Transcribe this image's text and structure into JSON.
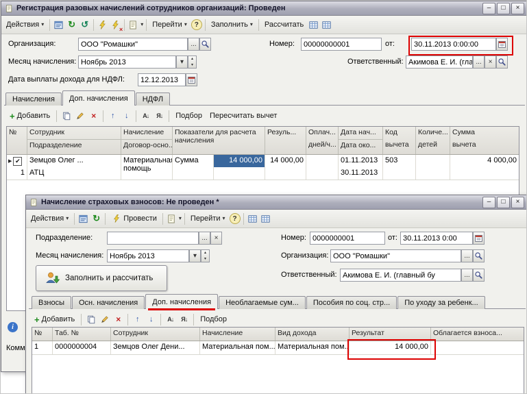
{
  "annotation_color": "#dd0000",
  "chrome": {
    "minimize": "–",
    "maximize": "□",
    "close": "×"
  },
  "glyphs": {
    "dropdown": "▾",
    "ellipsis": "...",
    "clear": "×",
    "spin_up": "▴",
    "spin_down": "▾",
    "help": "?",
    "marker": "▶",
    "check": "✔",
    "plus": "+",
    "remove": "×",
    "move_up": "↑",
    "move_down": "↓",
    "sort_asc": "А↓",
    "sort_desc": "Я↓",
    "refresh": "↻",
    "refresh2": "↺",
    "info": "i"
  },
  "win1": {
    "title": "Регистрация разовых начислений сотрудников организаций: Проведен",
    "toolbar": {
      "actions": "Действия",
      "goto": "Перейти",
      "fill": "Заполнить",
      "calc": "Рассчитать"
    },
    "fields": {
      "org_label": "Организация:",
      "org_value": "ООО \"Ромашки\"",
      "number_label": "Номер:",
      "number_value": "00000000001",
      "from_label": "от:",
      "date_value": "30.11.2013  0:00:00",
      "month_label": "Месяц начисления:",
      "month_value": "Ноябрь 2013",
      "resp_label": "Ответственный:",
      "resp_value": "Акимова Е. И. (главный бухгалтер)",
      "ndfl_label": "Дата выплаты дохода для НДФЛ:",
      "ndfl_value": "12.12.2013"
    },
    "tabs": [
      "Начисления",
      "Доп. начисления",
      "НДФЛ"
    ],
    "grid_toolbar": {
      "add": "Добавить",
      "pick": "Подбор",
      "recalc": "Пересчитать вычет"
    },
    "grid": {
      "headers": [
        {
          "top": "№",
          "bottom": ""
        },
        {
          "top": "Сотрудник",
          "bottom": "Подразделение"
        },
        {
          "top": "Начисление",
          "bottom": "Договор-осно..."
        },
        {
          "top": "Показатели для расчета начисления",
          "bottom": ""
        },
        {
          "top": "Резуль...",
          "bottom": ""
        },
        {
          "top": "Оплач...",
          "bottom": "дней/ч..."
        },
        {
          "top": "Дата нач...",
          "bottom": "Дата око..."
        },
        {
          "top": "Код",
          "bottom": "вычета"
        },
        {
          "top": "Количе...",
          "bottom": "детей"
        },
        {
          "top": "Сумма",
          "bottom": "вычета"
        }
      ],
      "row": {
        "num": "1",
        "employee": "Земцов Олег ...",
        "department": "АТЦ",
        "accrual": "Материальная помощь",
        "contract": "",
        "indicator": "Сумма",
        "indicator_value": "14 000,00",
        "result": "14 000,00",
        "paid": "",
        "date_start": "01.11.2013",
        "date_end": "30.11.2013",
        "code": "503",
        "children": "",
        "deduction": "4 000,00"
      }
    },
    "comment_label": "Комм"
  },
  "win2": {
    "title": "Начисление страховых взносов: Не проведен *",
    "toolbar": {
      "actions": "Действия",
      "post": "Провести",
      "goto": "Перейти"
    },
    "fields": {
      "dept_label": "Подразделение:",
      "dept_value": "",
      "number_label": "Номер:",
      "number_value": "0000000001",
      "from_label": "от:",
      "date_value": "30.11.2013 0:00",
      "month_label": "Месяц начисления:",
      "month_value": "Ноябрь 2013",
      "org_label": "Организация:",
      "org_value": "ООО \"Ромашки\"",
      "resp_label": "Ответственный:",
      "resp_value": "Акимова Е. И. (главный бу"
    },
    "fill_calc_button": "Заполнить и рассчитать",
    "tabs": [
      "Взносы",
      "Осн. начисления",
      "Доп. начисления",
      "Необлагаемые сум...",
      "Пособия по соц. стр...",
      "По уходу за ребенк..."
    ],
    "grid_toolbar": {
      "add": "Добавить",
      "pick": "Подбор"
    },
    "grid": {
      "headers": [
        "№",
        "Таб. №",
        "Сотрудник",
        "Начисление",
        "Вид дохода",
        "Результат",
        "Облагается взноса..."
      ],
      "row": [
        "1",
        "0000000004",
        "Земцов Олег Дени...",
        "Материальная пом...",
        "Материальная пом...",
        "14 000,00",
        ""
      ]
    }
  }
}
